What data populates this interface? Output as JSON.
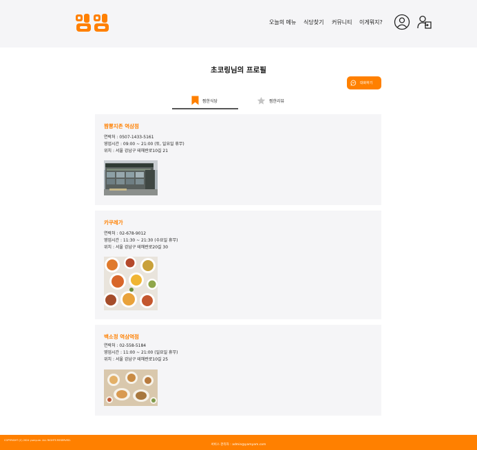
{
  "header": {
    "logo_text": "냠냠",
    "nav": [
      {
        "label": "오늘의 메뉴"
      },
      {
        "label": "식당찾기"
      },
      {
        "label": "커뮤니티"
      },
      {
        "label": "이게뭐지?"
      }
    ],
    "icons": [
      "user-icon",
      "logout-icon"
    ]
  },
  "profile": {
    "title": "초코링님의 프로필",
    "chat_button": "대화하기"
  },
  "tabs": [
    {
      "label": "찜한식당",
      "icon": "bookmark-icon",
      "active": true
    },
    {
      "label": "찜한리뷰",
      "icon": "star-icon",
      "active": false
    }
  ],
  "restaurants": [
    {
      "name": "짬뽕지존 역삼점",
      "phone": "연락처 : 0507-1433-5161",
      "hours": "영업시간 : 09:00 ~ 21:00 (토, 일요일 휴무)",
      "address": "위치 : 서울 강남구 테헤란로10길 21",
      "image": "building-photo"
    },
    {
      "name": "카쿠레가",
      "phone": "연락처 : 02-678-9012",
      "hours": "영업시간 : 11:30 ~ 21:30 (수요일 휴무)",
      "address": "위치 : 서울 강남구 테헤란로20길 30",
      "image": "food-spread-photo"
    },
    {
      "name": "백소정 역삼역점",
      "phone": "연락처 : 02-558-5184",
      "hours": "영업시간 : 11:00 ~ 21:00 (일요일 휴무)",
      "address": "위치 : 서울 강남구 테헤란로10길 25",
      "image": "food-table-photo"
    }
  ],
  "footer": {
    "copyright": "COPYRIGHT (C) 2024 yumyum. ALL RIGHTS RESERVED.",
    "contact": "서비스 관리자 : admin@yamyam.com"
  },
  "colors": {
    "accent": "#ff8000",
    "header_bg": "#f5f5f7",
    "card_bg": "#f5f5f7"
  }
}
